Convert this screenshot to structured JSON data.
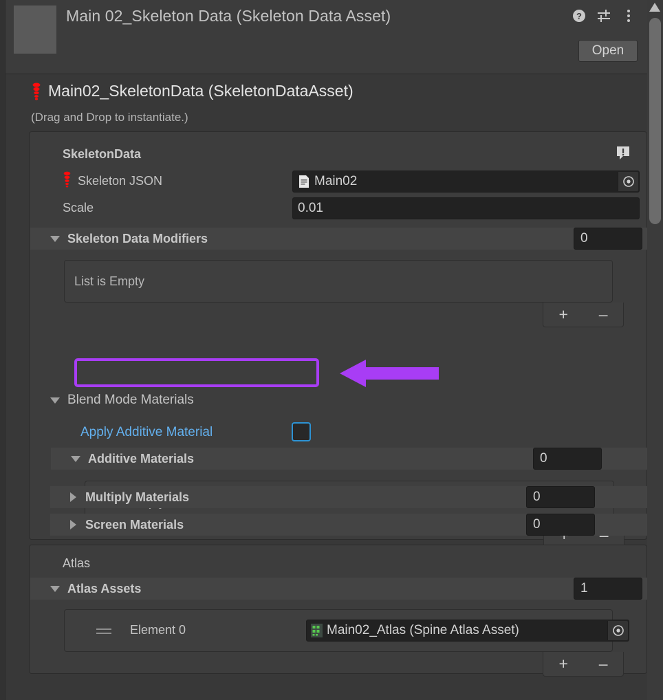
{
  "header": {
    "title": "Main 02_Skeleton Data (Skeleton Data Asset)",
    "open_label": "Open",
    "icons": {
      "help": "help-icon",
      "preset": "preset-settings-icon",
      "menu": "kebab-menu-icon"
    }
  },
  "asset": {
    "icon": "spine-icon",
    "title": "Main02_SkeletonData (SkeletonDataAsset)",
    "subtitle": "(Drag and Drop to instantiate.)"
  },
  "skeleton_data": {
    "section_title": "SkeletonData",
    "warning_icon": "warning-bubble-icon",
    "skeleton_json": {
      "label": "Skeleton JSON",
      "label_icon": "spine-icon",
      "value": "Main02",
      "value_icon": "text-asset-icon",
      "picker_icon": "object-picker-icon"
    },
    "scale": {
      "label": "Scale",
      "value": "0.01"
    },
    "modifiers": {
      "label": "Skeleton Data Modifiers",
      "count": "0",
      "empty_text": "List is Empty",
      "add_label": "+",
      "remove_label": "–",
      "expanded": true
    }
  },
  "blend_mode_materials": {
    "label": "Blend Mode Materials",
    "expanded": true,
    "apply_additive": {
      "label": "Apply Additive Material",
      "checked": false
    },
    "additive_materials": {
      "label": "Additive Materials",
      "count": "0",
      "empty_text": "List is Empty",
      "add_label": "+",
      "remove_label": "–",
      "expanded": true
    },
    "multiply_materials": {
      "label": "Multiply Materials",
      "count": "0",
      "expanded": false
    },
    "screen_materials": {
      "label": "Screen Materials",
      "count": "0",
      "expanded": false
    }
  },
  "atlas": {
    "section_title": "Atlas",
    "atlas_assets": {
      "label": "Atlas Assets",
      "count": "1",
      "expanded": true,
      "add_label": "+",
      "remove_label": "–",
      "elements": [
        {
          "label": "Element 0",
          "value": "Main02_Atlas (Spine Atlas Asset)",
          "value_icon": "atlas-texture-icon",
          "picker_icon": "object-picker-icon"
        }
      ]
    }
  },
  "annotation": {
    "highlight_color": "#a83df5",
    "arrow_icon": "left-arrow-annotation"
  },
  "scrollbar": {
    "up_arrow_icon": "scroll-up-arrow-icon"
  }
}
